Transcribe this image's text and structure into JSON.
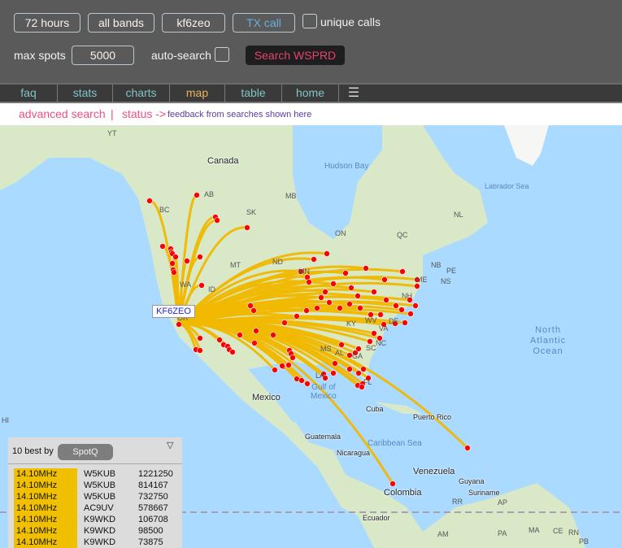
{
  "toolbar": {
    "hours": "72 hours",
    "bands": "all bands",
    "callsign": "kf6zeo",
    "call_mode": "TX call",
    "unique_calls_label": "unique calls",
    "unique_calls_checked": false,
    "max_spots_label": "max spots",
    "max_spots_value": "5000",
    "auto_search_label": "auto-search",
    "auto_search_checked": false,
    "search_button": "Search WSPRD"
  },
  "nav": {
    "items": [
      {
        "label": "faq",
        "active": false
      },
      {
        "label": "stats",
        "active": false
      },
      {
        "label": "charts",
        "active": false
      },
      {
        "label": "map",
        "active": true
      },
      {
        "label": "table",
        "active": false
      },
      {
        "label": "home",
        "active": false
      }
    ],
    "menu_icon": "hamburger-icon"
  },
  "status": {
    "advanced_search": "advanced search",
    "separator": "|",
    "status_label": "status ->",
    "feedback": "feedback from searches shown here"
  },
  "map": {
    "tx_station_label": "KF6ZEO",
    "labels": {
      "canada": "Canada",
      "hudson_bay": "Hudson Bay",
      "labrador_sea": "Labrador Sea",
      "north_atlantic": [
        "North",
        "Atlantic",
        "Ocean"
      ],
      "gulf_of_mexico": [
        "Gulf of",
        "Mexico"
      ],
      "mexico": "Mexico",
      "cuba": "Cuba",
      "puerto_rico": "Puerto Rico",
      "guatemala": "Guatemala",
      "nicaragua": "Nicaragua",
      "caribbean_sea": "Caribbean Sea",
      "venezuela": "Venezuela",
      "colombia": "Colombia",
      "guyana": "Guyana",
      "suriname": "Suriname",
      "ecuador": "Ecuador",
      "regions": [
        "YT",
        "BC",
        "AB",
        "SK",
        "MB",
        "ON",
        "QC",
        "NL",
        "NB",
        "PE",
        "NS",
        "ME",
        "NH",
        "MT",
        "ND",
        "MN",
        "ID",
        "WA",
        "OR",
        "KY",
        "WV",
        "VA",
        "DE",
        "NC",
        "SC",
        "GA",
        "AL",
        "MS",
        "LA",
        "FL",
        "HI",
        "RR",
        "AP",
        "AM",
        "PA",
        "MA",
        "CE",
        "RN",
        "PB"
      ]
    },
    "colors": {
      "path": "#f0b800",
      "spot": "#ff0000",
      "water": "#aadaff",
      "land": "#d6e8c4"
    }
  },
  "best_panel": {
    "title": "10 best by",
    "sort_button": "SpotQ",
    "menu_icon": "triangle-down-icon",
    "rows": [
      {
        "band": "14.10MHz",
        "call": "W5KUB",
        "value": "1221250"
      },
      {
        "band": "14.10MHz",
        "call": "W5KUB",
        "value": "814167"
      },
      {
        "band": "14.10MHz",
        "call": "W5KUB",
        "value": "732750"
      },
      {
        "band": "14.10MHz",
        "call": "AC9UV",
        "value": "578667"
      },
      {
        "band": "14.10MHz",
        "call": "K9WKD",
        "value": "106708"
      },
      {
        "band": "14.10MHz",
        "call": "K9WKD",
        "value": "98500"
      },
      {
        "band": "14.10MHz",
        "call": "K9WKD",
        "value": "73875"
      }
    ]
  }
}
